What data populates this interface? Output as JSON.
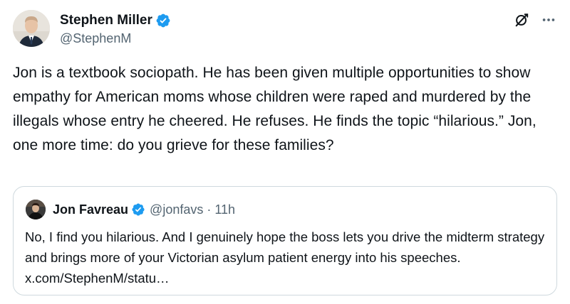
{
  "tweet": {
    "author": {
      "display_name": "Stephen Miller",
      "handle": "@StephenM",
      "verified": true,
      "avatar_icon": "user-avatar"
    },
    "text": "Jon is a textbook sociopath. He has been given multiple opportunities to show empathy for American moms whose children were raped and murdered by the illegals whose entry he cheered. He refuses. He finds the topic “hilarious.” Jon, one more time: do you grieve for these families?",
    "actions": {
      "grok_icon": "grok-icon",
      "more_icon": "more-icon",
      "more_label": "···"
    }
  },
  "quote": {
    "author": {
      "display_name": "Jon Favreau",
      "handle": "@jonfavs",
      "verified": true
    },
    "separator": "·",
    "time": "11h",
    "text": "No, I find you hilarious. And I genuinely hope the boss lets you drive the midterm strategy and brings more of your Victorian asylum patient energy into his speeches. x.com/StephenM/statu…"
  },
  "colors": {
    "text_primary": "#0f1419",
    "text_secondary": "#536471",
    "verified_blue": "#1d9bf0",
    "border": "#cfd9de"
  }
}
